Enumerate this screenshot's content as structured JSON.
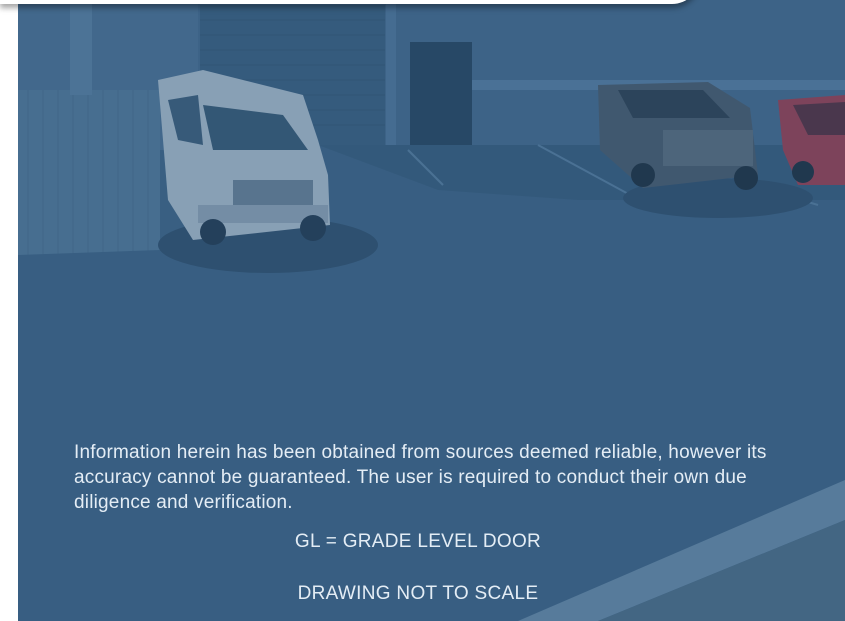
{
  "overlay": {
    "disclaimer": "Information herein has been obtained from sources deemed reliable, however its accuracy cannot be guaranteed. The user is required to conduct their own due diligence and verification.",
    "legend": "GL = GRADE LEVEL DOOR",
    "scale_note": "DRAWING NOT TO SCALE"
  },
  "colors": {
    "tint": "#3f6383",
    "text": "#e4edf5"
  }
}
